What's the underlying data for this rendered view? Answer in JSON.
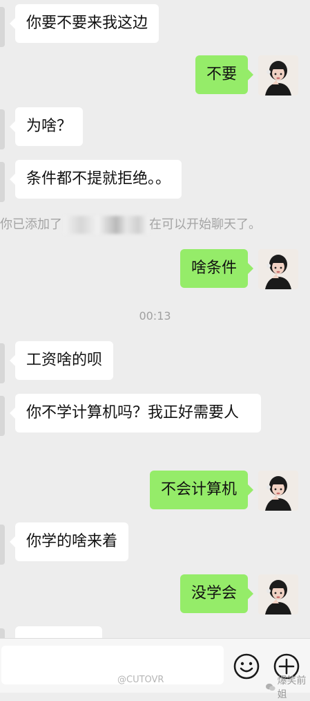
{
  "messages": [
    {
      "text": "你要不要来我这边"
    },
    {
      "text": "不要"
    },
    {
      "text": "为啥？"
    },
    {
      "text": "条件都不提就拒绝。。"
    },
    {
      "text": "啥条件"
    },
    {
      "text": "工资啥的呗"
    },
    {
      "text": "你不学计算机吗？我正好需要人"
    },
    {
      "text": "不会计算机"
    },
    {
      "text": "你学的啥来着"
    },
    {
      "text": "没学会"
    }
  ],
  "system_notice": {
    "before": "你已添加了",
    "after": "在可以开始聊天了。"
  },
  "timestamp": "00:13",
  "input": {
    "placeholder": ""
  },
  "watermark": {
    "weibo": "@CUTOVR",
    "account": "爆笑前姐"
  },
  "colors": {
    "outgoing_bubble": "#95ec69",
    "incoming_bubble": "#ffffff",
    "background": "#ededed"
  }
}
